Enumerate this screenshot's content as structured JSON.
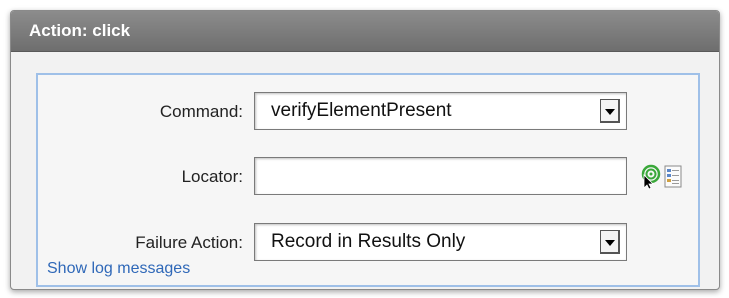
{
  "header": {
    "prefix": "Action:",
    "action_name": "click"
  },
  "form": {
    "command": {
      "label": "Command:",
      "value": "verifyElementPresent"
    },
    "locator": {
      "label": "Locator:",
      "value": "",
      "icons": [
        "target-picker-icon",
        "element-list-icon"
      ]
    },
    "failure_action": {
      "label": "Failure Action:",
      "value": "Record in Results Only"
    },
    "log_link": "Show log messages"
  },
  "colors": {
    "header_bg": "#7a7a7a",
    "focus_border": "#9fc0e8",
    "link": "#2f68b8",
    "picker_green": "#3aa83a"
  }
}
